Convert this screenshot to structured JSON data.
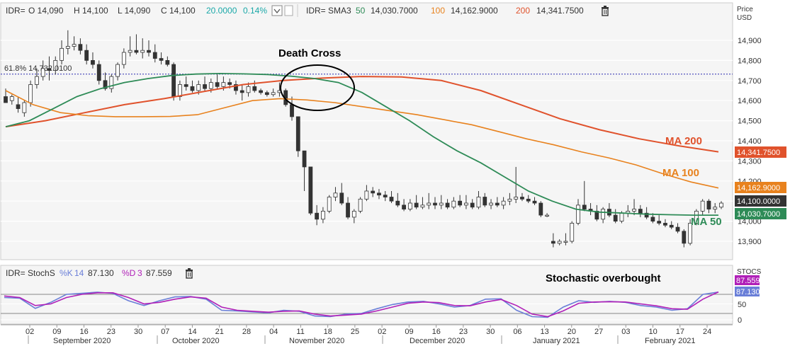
{
  "colors": {
    "ma50": "#2e8b57",
    "ma100": "#e8821e",
    "ma200": "#e0522c",
    "k_line": "#6a7fd8",
    "d_line": "#b020b8",
    "fib": "#2d2db0",
    "panel_bg": "#f5f5f5",
    "grid": "#ffffff"
  },
  "header": {
    "symbol": "IDR=",
    "o": "O 14,090",
    "h": "H 14,100",
    "l": "L 14,090",
    "c": "C 14,100",
    "chg": "20.0000",
    "chg_pct": "0.14%",
    "sma_symbol": "IDR= SMA3",
    "sma1_period": "50",
    "sma1_value": "14,030.7000",
    "sma2_period": "100",
    "sma2_value": "14,162.9000",
    "sma3_period": "200",
    "sma3_value": "14,341.7500",
    "dropdown_icon": "chevron-down-icon",
    "trash_icon": "trash-icon"
  },
  "stoch_header": {
    "symbol": "IDR= StochS",
    "k_label": "%K",
    "k_period": "14",
    "k_value": "87.130",
    "d_label": "%D",
    "d_period": "3",
    "d_value": "87.559"
  },
  "annotations": {
    "death_cross": "Death Cross",
    "ma200": "MA 200",
    "ma100": "MA 100",
    "ma50": "MA 50",
    "stoch": "Stochastic overbought",
    "fib": "61.8% 14,732.0100"
  },
  "price_axis": {
    "title1": "Price",
    "title2": "USD",
    "ticks": [
      "14,900",
      "14,800",
      "14,700",
      "14,600",
      "14,500",
      "14,400",
      "14,300",
      "14,200",
      "14,100",
      "14,000",
      "13,900"
    ]
  },
  "price_tags": {
    "ma200": "14,341.7500",
    "ma100": "14,162.9000",
    "last": "14,100.0000",
    "ma50": "14,030.7000"
  },
  "stoch_axis": {
    "title": "STOCS",
    "ticks": [
      "50",
      "0"
    ],
    "d_tag": "87.559",
    "k_tag": "87.130"
  },
  "x_axis": {
    "day_ticks": [
      "02",
      "09",
      "16",
      "23",
      "30",
      "07",
      "14",
      "21",
      "28",
      "04",
      "11",
      "18",
      "25",
      "02",
      "09",
      "16",
      "23",
      "30",
      "06",
      "13",
      "20",
      "27",
      "03",
      "10",
      "17",
      "24"
    ],
    "months": [
      "September 2020",
      "October 2020",
      "November 2020",
      "December 2020",
      "January 2021",
      "February 2021"
    ]
  },
  "chart_data": {
    "type": "candlestick",
    "y_range": [
      13850,
      14960
    ],
    "fib_level": 14732.01,
    "candles": [
      [
        14620,
        14660,
        14600,
        14590
      ],
      [
        14600,
        14630,
        14580,
        14620
      ],
      [
        14580,
        14620,
        14540,
        14560
      ],
      [
        14540,
        14600,
        14520,
        14590
      ],
      [
        14590,
        14700,
        14570,
        14680
      ],
      [
        14680,
        14760,
        14660,
        14720
      ],
      [
        14720,
        14800,
        14700,
        14760
      ],
      [
        14760,
        14820,
        14700,
        14750
      ],
      [
        14750,
        14820,
        14730,
        14800
      ],
      [
        14800,
        14900,
        14780,
        14860
      ],
      [
        14860,
        14950,
        14830,
        14870
      ],
      [
        14870,
        14920,
        14850,
        14880
      ],
      [
        14880,
        14910,
        14830,
        14850
      ],
      [
        14850,
        14880,
        14780,
        14800
      ],
      [
        14800,
        14840,
        14760,
        14780
      ],
      [
        14780,
        14800,
        14680,
        14700
      ],
      [
        14700,
        14740,
        14650,
        14660
      ],
      [
        14660,
        14730,
        14640,
        14720
      ],
      [
        14720,
        14790,
        14700,
        14780
      ],
      [
        14780,
        14860,
        14760,
        14840
      ],
      [
        14840,
        14920,
        14820,
        14850
      ],
      [
        14850,
        14930,
        14830,
        14840
      ],
      [
        14840,
        14910,
        14810,
        14850
      ],
      [
        14850,
        14900,
        14820,
        14840
      ],
      [
        14840,
        14880,
        14790,
        14810
      ],
      [
        14810,
        14840,
        14780,
        14800
      ],
      [
        14800,
        14820,
        14770,
        14780
      ],
      [
        14780,
        14790,
        14600,
        14620
      ],
      [
        14620,
        14700,
        14600,
        14680
      ],
      [
        14680,
        14720,
        14650,
        14670
      ],
      [
        14670,
        14700,
        14640,
        14650
      ],
      [
        14650,
        14700,
        14630,
        14680
      ],
      [
        14680,
        14720,
        14650,
        14660
      ],
      [
        14660,
        14710,
        14640,
        14690
      ],
      [
        14690,
        14730,
        14660,
        14670
      ],
      [
        14670,
        14720,
        14650,
        14690
      ],
      [
        14690,
        14710,
        14660,
        14680
      ],
      [
        14680,
        14700,
        14630,
        14650
      ],
      [
        14650,
        14680,
        14600,
        14640
      ],
      [
        14640,
        14690,
        14620,
        14670
      ],
      [
        14670,
        14700,
        14640,
        14650
      ],
      [
        14650,
        14660,
        14630,
        14640
      ],
      [
        14640,
        14650,
        14620,
        14630
      ],
      [
        14630,
        14660,
        14620,
        14640
      ],
      [
        14640,
        14690,
        14620,
        14650
      ],
      [
        14650,
        14660,
        14570,
        14580
      ],
      [
        14580,
        14620,
        14500,
        14520
      ],
      [
        14520,
        14420,
        14320,
        14350
      ],
      [
        14350,
        14280,
        14150,
        14270
      ],
      [
        14270,
        14240,
        14030,
        14040
      ],
      [
        14040,
        14080,
        13980,
        14010
      ],
      [
        14010,
        14070,
        13990,
        14050
      ],
      [
        14050,
        14130,
        14040,
        14120
      ],
      [
        14120,
        14170,
        14100,
        14140
      ],
      [
        14140,
        14190,
        14080,
        14090
      ],
      [
        14090,
        14120,
        14010,
        14020
      ],
      [
        14020,
        14060,
        13990,
        14050
      ],
      [
        14050,
        14120,
        14040,
        14110
      ],
      [
        14110,
        14180,
        14100,
        14150
      ],
      [
        14150,
        14170,
        14120,
        14140
      ],
      [
        14140,
        14160,
        14110,
        14130
      ],
      [
        14130,
        14150,
        14100,
        14120
      ],
      [
        14120,
        14150,
        14090,
        14100
      ],
      [
        14100,
        14140,
        14070,
        14080
      ],
      [
        14080,
        14110,
        14050,
        14060
      ],
      [
        14060,
        14110,
        14050,
        14090
      ],
      [
        14090,
        14130,
        14060,
        14070
      ],
      [
        14070,
        14120,
        14060,
        14080
      ],
      [
        14080,
        14140,
        14060,
        14090
      ],
      [
        14090,
        14120,
        14060,
        14080
      ],
      [
        14080,
        14130,
        14060,
        14090
      ],
      [
        14090,
        14110,
        14060,
        14070
      ],
      [
        14070,
        14120,
        14060,
        14100
      ],
      [
        14100,
        14130,
        14070,
        14080
      ],
      [
        14080,
        14130,
        14060,
        14090
      ],
      [
        14090,
        14110,
        14060,
        14070
      ],
      [
        14070,
        14150,
        14060,
        14120
      ],
      [
        14120,
        14140,
        14070,
        14080
      ],
      [
        14080,
        14110,
        14060,
        14090
      ],
      [
        14090,
        14120,
        14070,
        14080
      ],
      [
        14080,
        14120,
        14060,
        14100
      ],
      [
        14100,
        14140,
        14080,
        14110
      ],
      [
        14110,
        14270,
        14090,
        14120
      ],
      [
        14120,
        14140,
        14100,
        14110
      ],
      [
        14110,
        14130,
        14090,
        14100
      ],
      [
        14100,
        14120,
        14080,
        14090
      ],
      [
        14090,
        14100,
        14020,
        14030
      ],
      [
        14030,
        14040,
        14020,
        14030
      ],
      [
        13900,
        13940,
        13870,
        13890
      ],
      [
        13890,
        13910,
        13880,
        13900
      ],
      [
        13900,
        13940,
        13880,
        13900
      ],
      [
        13900,
        14000,
        13890,
        13990
      ],
      [
        13990,
        14110,
        13980,
        14080
      ],
      [
        14080,
        14200,
        14050,
        14060
      ],
      [
        14060,
        14090,
        14030,
        14050
      ],
      [
        14050,
        14080,
        14000,
        14010
      ],
      [
        14010,
        14070,
        13990,
        14060
      ],
      [
        14060,
        14090,
        14020,
        14030
      ],
      [
        14030,
        14060,
        13990,
        14000
      ],
      [
        14000,
        14050,
        13990,
        14040
      ],
      [
        14040,
        14080,
        14020,
        14050
      ],
      [
        14050,
        14110,
        14030,
        14060
      ],
      [
        14060,
        14080,
        14020,
        14040
      ],
      [
        14040,
        14070,
        14010,
        14020
      ],
      [
        14020,
        14040,
        13990,
        14000
      ],
      [
        14000,
        14030,
        13980,
        13990
      ],
      [
        13990,
        14010,
        13970,
        13980
      ],
      [
        13980,
        14000,
        13960,
        13970
      ],
      [
        13970,
        13990,
        13940,
        13950
      ],
      [
        13950,
        13960,
        13870,
        13890
      ],
      [
        13890,
        14010,
        13880,
        13990
      ],
      [
        13990,
        14060,
        13980,
        14050
      ],
      [
        14050,
        14110,
        14030,
        14100
      ],
      [
        14100,
        14110,
        14040,
        14060
      ],
      [
        14060,
        14090,
        14040,
        14070
      ],
      [
        14070,
        14100,
        14060,
        14090
      ]
    ],
    "ma50": [
      14470,
      14500,
      14560,
      14620,
      14660,
      14690,
      14710,
      14725,
      14732,
      14735,
      14733,
      14730,
      14722,
      14710,
      14690,
      14640,
      14570,
      14500,
      14420,
      14350,
      14290,
      14220,
      14150,
      14100,
      14060,
      14045,
      14040,
      14035,
      14032,
      14030,
      14030
    ],
    "ma100": [
      14650,
      14580,
      14540,
      14525,
      14520,
      14520,
      14521,
      14530,
      14565,
      14600,
      14610,
      14603,
      14590,
      14570,
      14550,
      14530,
      14505,
      14480,
      14445,
      14410,
      14380,
      14345,
      14315,
      14280,
      14235,
      14195,
      14165
    ],
    "ma200": [
      14470,
      14500,
      14540,
      14580,
      14610,
      14645,
      14680,
      14700,
      14712,
      14720,
      14718,
      14700,
      14650,
      14580,
      14510,
      14455,
      14410,
      14375,
      14345
    ],
    "stoch_k": [
      70,
      68,
      36,
      55,
      80,
      83,
      87,
      83,
      60,
      45,
      60,
      72,
      73,
      65,
      30,
      28,
      25,
      22,
      30,
      27,
      12,
      10,
      18,
      20,
      35,
      48,
      56,
      58,
      50,
      40,
      45,
      65,
      66,
      30,
      10,
      8,
      40,
      60,
      55,
      58,
      55,
      45,
      40,
      30,
      35,
      80,
      87.13
    ],
    "stoch_d": [
      75,
      70,
      45,
      50,
      70,
      80,
      85,
      85,
      70,
      50,
      55,
      65,
      72,
      68,
      40,
      30,
      27,
      24,
      27,
      28,
      18,
      12,
      15,
      18,
      28,
      40,
      52,
      56,
      54,
      45,
      44,
      56,
      64,
      45,
      18,
      10,
      28,
      52,
      56,
      57,
      56,
      50,
      44,
      35,
      33,
      65,
      87.559
    ]
  }
}
